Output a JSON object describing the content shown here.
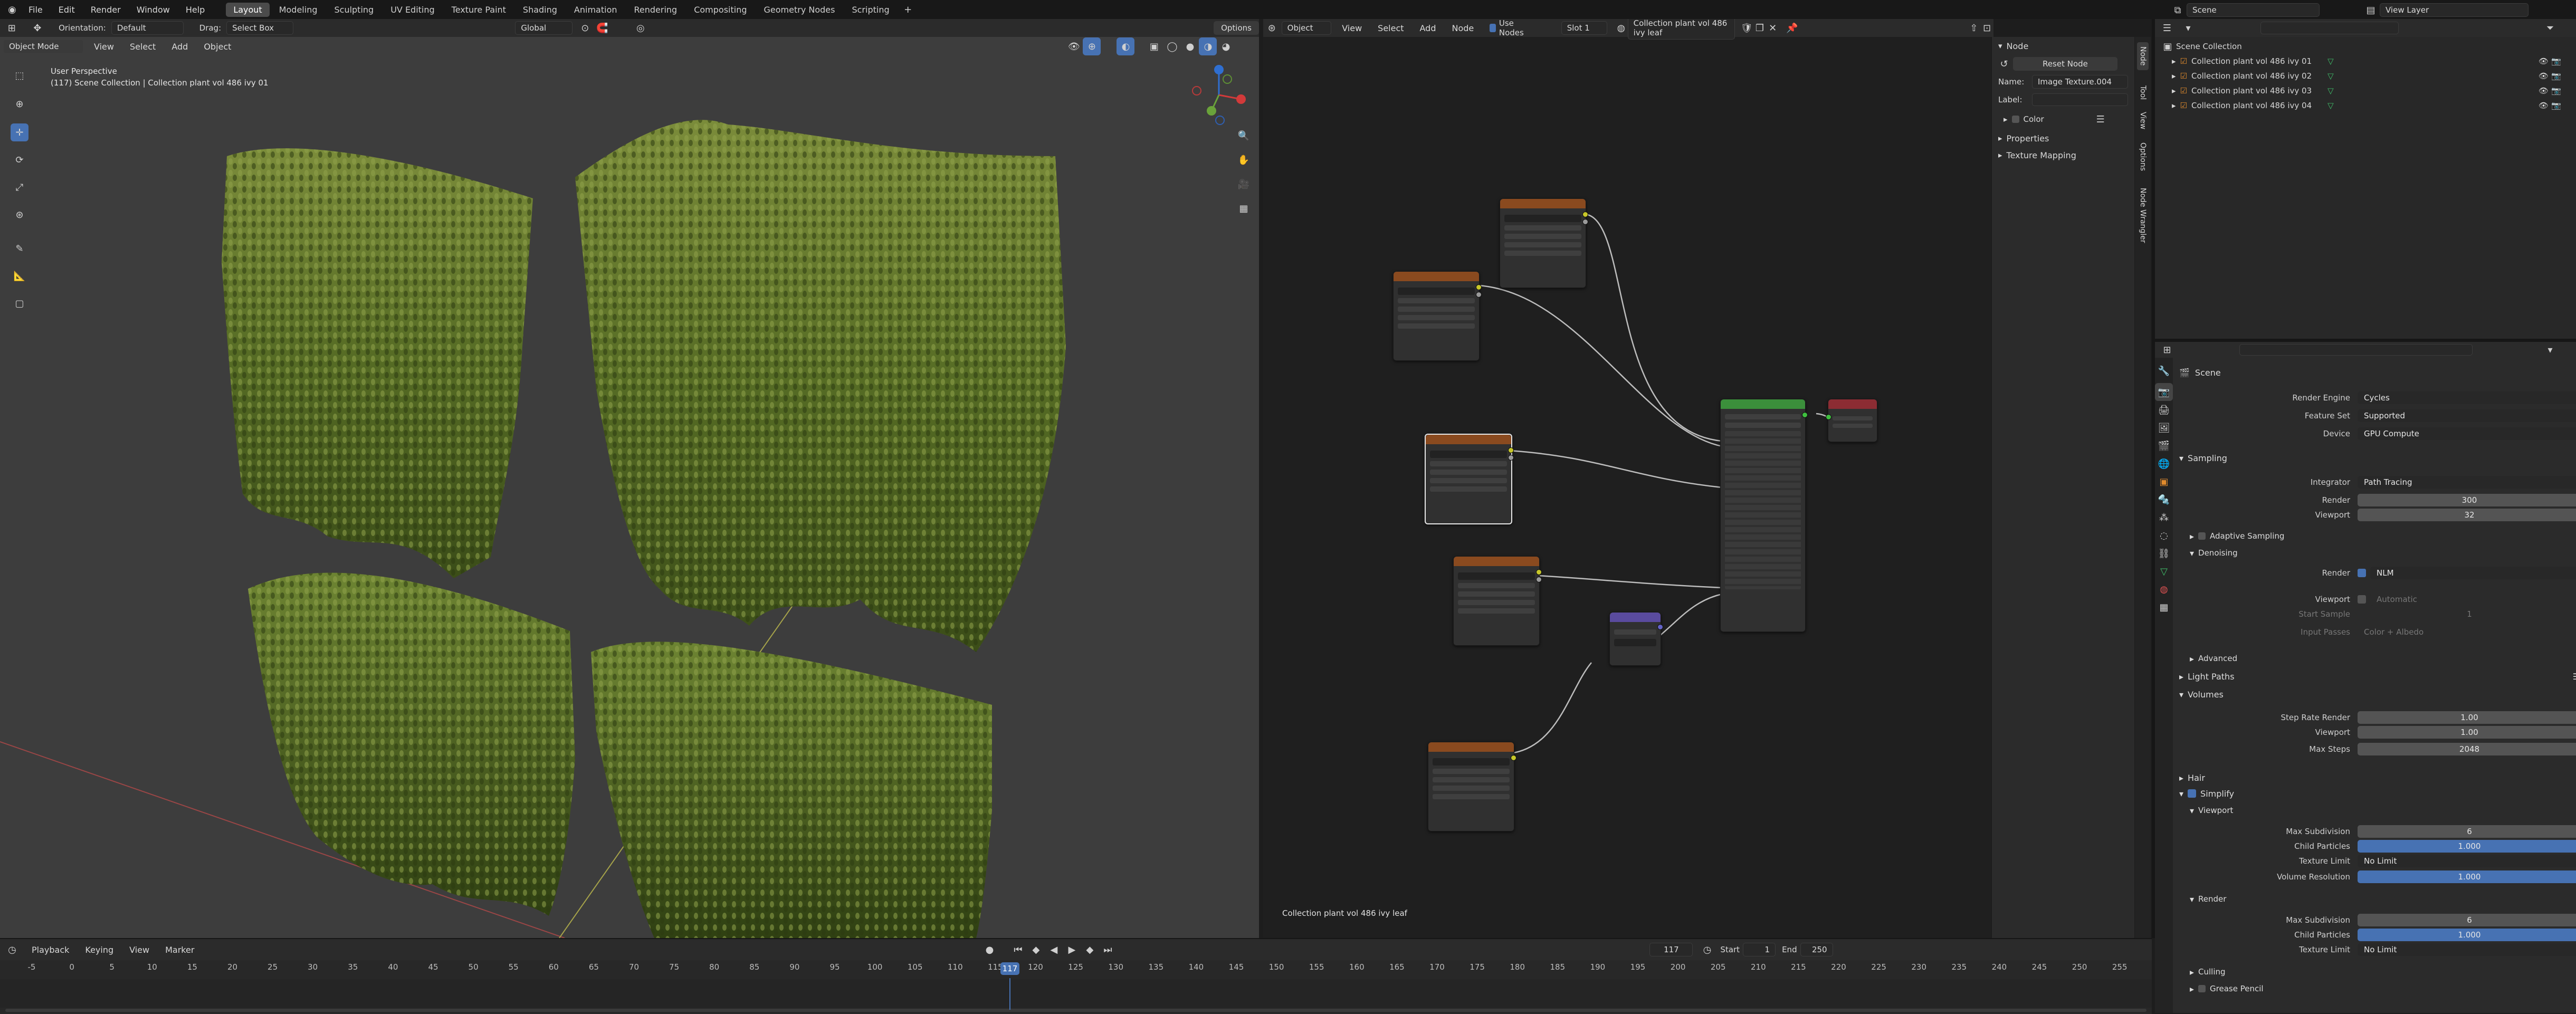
{
  "topbar": {
    "menus": [
      "File",
      "Edit",
      "Render",
      "Window",
      "Help"
    ],
    "workspaces": [
      "Layout",
      "Modeling",
      "Sculpting",
      "UV Editing",
      "Texture Paint",
      "Shading",
      "Animation",
      "Rendering",
      "Compositing",
      "Geometry Nodes",
      "Scripting"
    ],
    "active_workspace": "Layout",
    "scene_name": "Scene",
    "view_layer": "View Layer"
  },
  "viewport": {
    "orientation_label": "Orientation:",
    "orientation_value": "Default",
    "drag_label": "Drag:",
    "drag_value": "Select Box",
    "mode": "Object Mode",
    "menus": [
      "View",
      "Select",
      "Add",
      "Object"
    ],
    "transform_space": "Global",
    "options": "Options",
    "info_line1": "User Perspective",
    "info_line2": "(117) Scene Collection | Collection plant vol 486 ivy 01"
  },
  "node_editor": {
    "object_label": "Object",
    "menus": [
      "View",
      "Select",
      "Add",
      "Node"
    ],
    "use_nodes_label": "Use Nodes",
    "slot": "Slot 1",
    "material": "Collection plant vol 486 ivy leaf",
    "footer_material": "Collection plant vol 486 ivy leaf",
    "side_tabs": [
      "Node",
      "Tool",
      "View",
      "Options",
      "Node Wrangler"
    ],
    "panel": {
      "header": "Node",
      "reset_button": "Reset Node",
      "name_label": "Name:",
      "name_value": "Image Texture.004",
      "label_label": "Label:",
      "color_label": "Color",
      "properties": "Properties",
      "texture_mapping": "Texture Mapping"
    }
  },
  "outliner": {
    "root": "Scene Collection",
    "items": [
      "Collection plant vol 486 ivy 01",
      "Collection plant vol 486 ivy 02",
      "Collection plant vol 486 ivy 03",
      "Collection plant vol 486 ivy 04"
    ]
  },
  "properties": {
    "scene": "Scene",
    "render_engine_label": "Render Engine",
    "render_engine": "Cycles",
    "feature_set_label": "Feature Set",
    "feature_set": "Supported",
    "device_label": "Device",
    "device": "GPU Compute",
    "sampling": "Sampling",
    "integrator_label": "Integrator",
    "integrator": "Path Tracing",
    "render_label": "Render",
    "render_samples": "300",
    "viewport_label": "Viewport",
    "viewport_samples": "32",
    "adaptive_sampling": "Adaptive Sampling",
    "denoising": "Denoising",
    "denoise_render_label": "Render",
    "denoise_render_value": "NLM",
    "denoise_viewport_label": "Viewport",
    "denoise_viewport_value": "Automatic",
    "start_sample_label": "Start Sample",
    "start_sample_value": "1",
    "input_passes_label": "Input Passes",
    "input_passes_value": "Color + Albedo",
    "advanced": "Advanced",
    "light_paths": "Light Paths",
    "volumes": "Volumes",
    "step_rate_render_label": "Step Rate Render",
    "step_rate_render": "1.00",
    "step_viewport_label": "Viewport",
    "step_viewport": "1.00",
    "max_steps_label": "Max Steps",
    "max_steps": "2048",
    "hair": "Hair",
    "simplify": "Simplify",
    "simplify_viewport": "Viewport",
    "max_subdivision_label": "Max Subdivision",
    "max_subdivision_vp": "6",
    "child_particles_label": "Child Particles",
    "child_particles_vp": "1.000",
    "texture_limit_label": "Texture Limit",
    "texture_limit_vp": "No Limit",
    "volume_resolution_label": "Volume Resolution",
    "volume_resolution": "1.000",
    "simplify_render": "Render",
    "max_subdivision_r": "6",
    "child_particles_r": "1.000",
    "texture_limit_r": "No Limit",
    "culling": "Culling",
    "grease_pencil": "Grease Pencil"
  },
  "timeline": {
    "menus": [
      "Playback",
      "Keying",
      "View",
      "Marker"
    ],
    "current_frame": "117",
    "start_label": "Start",
    "start": "1",
    "end_label": "End",
    "end": "250",
    "ticks": [
      "-5",
      "0",
      "5",
      "10",
      "15",
      "20",
      "25",
      "30",
      "35",
      "40",
      "45",
      "50",
      "55",
      "60",
      "65",
      "70",
      "75",
      "80",
      "85",
      "90",
      "95",
      "100",
      "105",
      "110",
      "115",
      "120",
      "125",
      "130",
      "135",
      "140",
      "145",
      "150",
      "155",
      "160",
      "165",
      "170",
      "175",
      "180",
      "185",
      "190",
      "195",
      "200",
      "205",
      "210",
      "215",
      "220",
      "225",
      "230",
      "235",
      "240",
      "245",
      "250",
      "255"
    ],
    "playhead": "117"
  },
  "colors": {
    "accent": "#4772b3",
    "texture_node": "#8a4a1f",
    "bsdf_node": "#3b8f3b",
    "output_node": "#8c2c33",
    "vector_node": "#5a4b9e"
  }
}
